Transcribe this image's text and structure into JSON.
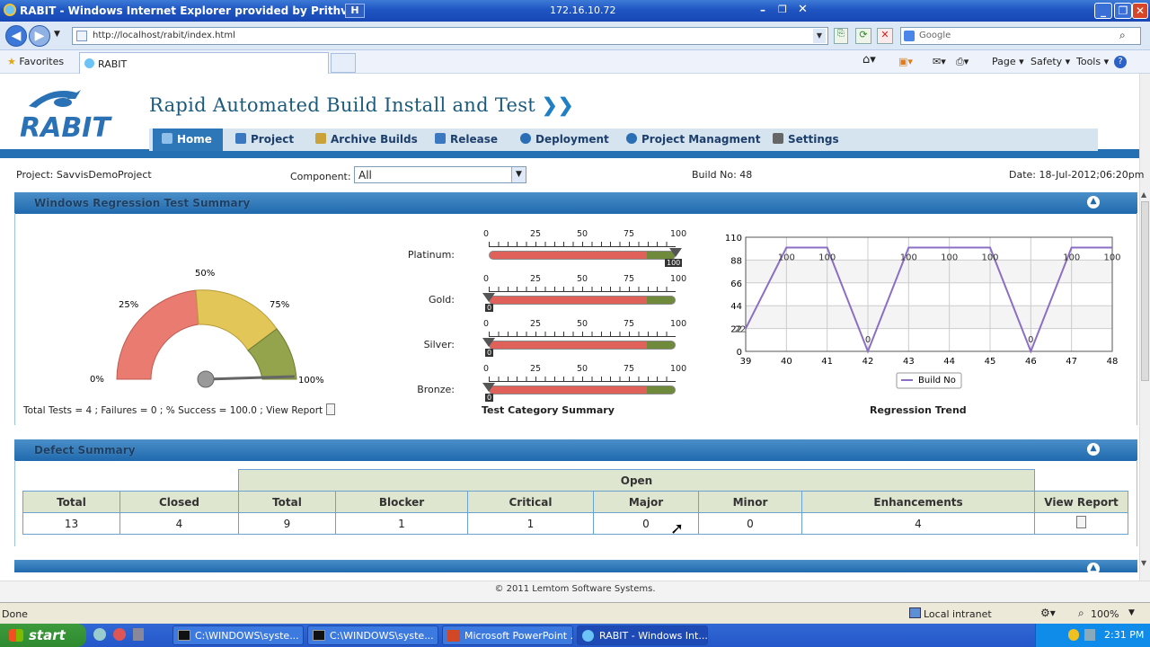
{
  "window": {
    "title": "RABIT - Windows Internet Explorer provided by Prithvi",
    "ip": "172.16.10.72"
  },
  "browser": {
    "address": "http://localhost/rabit/index.html",
    "search_placeholder": "Google",
    "favorites_label": "Favorites",
    "tab_label": "RABIT",
    "commands": [
      "Page ▾",
      "Safety ▾",
      "Tools ▾"
    ]
  },
  "app": {
    "title": "Rapid Automated Build Install and Test",
    "logo_text": "RABIT",
    "nav": [
      "Home",
      "Project",
      "Archive Builds",
      "Release",
      "Deployment",
      "Project Managment",
      "Settings"
    ]
  },
  "info": {
    "project": "Project: SavvisDemoProject",
    "component_label": "Component:",
    "component_value": "All",
    "build": "Build No: 48",
    "date": "Date: 18-Jul-2012;06:20pm"
  },
  "regression": {
    "section_title": "Windows Regression Test Summary",
    "gauge": {
      "labels": [
        "0%",
        "25%",
        "50%",
        "75%",
        "100%"
      ],
      "value_pct": 100
    },
    "summary_text": "Total Tests = 4 ; Failures = 0 ; % Success = 100.0 ; View Report",
    "category": {
      "title": "Test Category Summary",
      "scale": [
        "0",
        "25",
        "50",
        "75",
        "100"
      ],
      "rows": [
        {
          "name": "Platinum:",
          "value": 100
        },
        {
          "name": "Gold:",
          "value": 0
        },
        {
          "name": "Silver:",
          "value": 0
        },
        {
          "name": "Bronze:",
          "value": 0
        }
      ]
    },
    "trend_title": "Regression Trend"
  },
  "chart_data": {
    "type": "line",
    "x": [
      39,
      40,
      41,
      42,
      43,
      44,
      45,
      46,
      47,
      48
    ],
    "series": [
      {
        "name": "Build No",
        "values": [
          22,
          100,
          100,
          0,
          100,
          100,
          100,
          0,
          100,
          100
        ]
      }
    ],
    "data_labels": [
      "22",
      "100",
      "100",
      "0",
      "100",
      "100",
      "100",
      "0",
      "100",
      "100"
    ],
    "y_ticks": [
      0,
      22,
      44,
      66,
      88,
      110
    ],
    "ylim": [
      0,
      110
    ],
    "grid": true,
    "legend": "bottom-center"
  },
  "defects": {
    "section_title": "Defect Summary",
    "open_label": "Open",
    "headers": [
      "Total",
      "Closed",
      "Total",
      "Blocker",
      "Critical",
      "Major",
      "Minor",
      "Enhancements",
      "View Report"
    ],
    "values": [
      "13",
      "4",
      "9",
      "1",
      "1",
      "0",
      "0",
      "4"
    ]
  },
  "footer": "© 2011 Lemtom Software Systems.",
  "statusbar": {
    "left": "Done",
    "zone": "Local intranet",
    "zoom": "100%"
  },
  "taskbar": {
    "start": "start",
    "tasks": [
      "C:\\WINDOWS\\syste...",
      "C:\\WINDOWS\\syste...",
      "Microsoft PowerPoint ...",
      "RABIT - Windows Int..."
    ],
    "clock": "2:31 PM"
  },
  "colors": {
    "accent": "#2470b2",
    "nav_bg": "#d6e4ef",
    "bar_red": "#e0605a",
    "bar_green": "#6f8a3a",
    "line": "#8a6fc4"
  }
}
